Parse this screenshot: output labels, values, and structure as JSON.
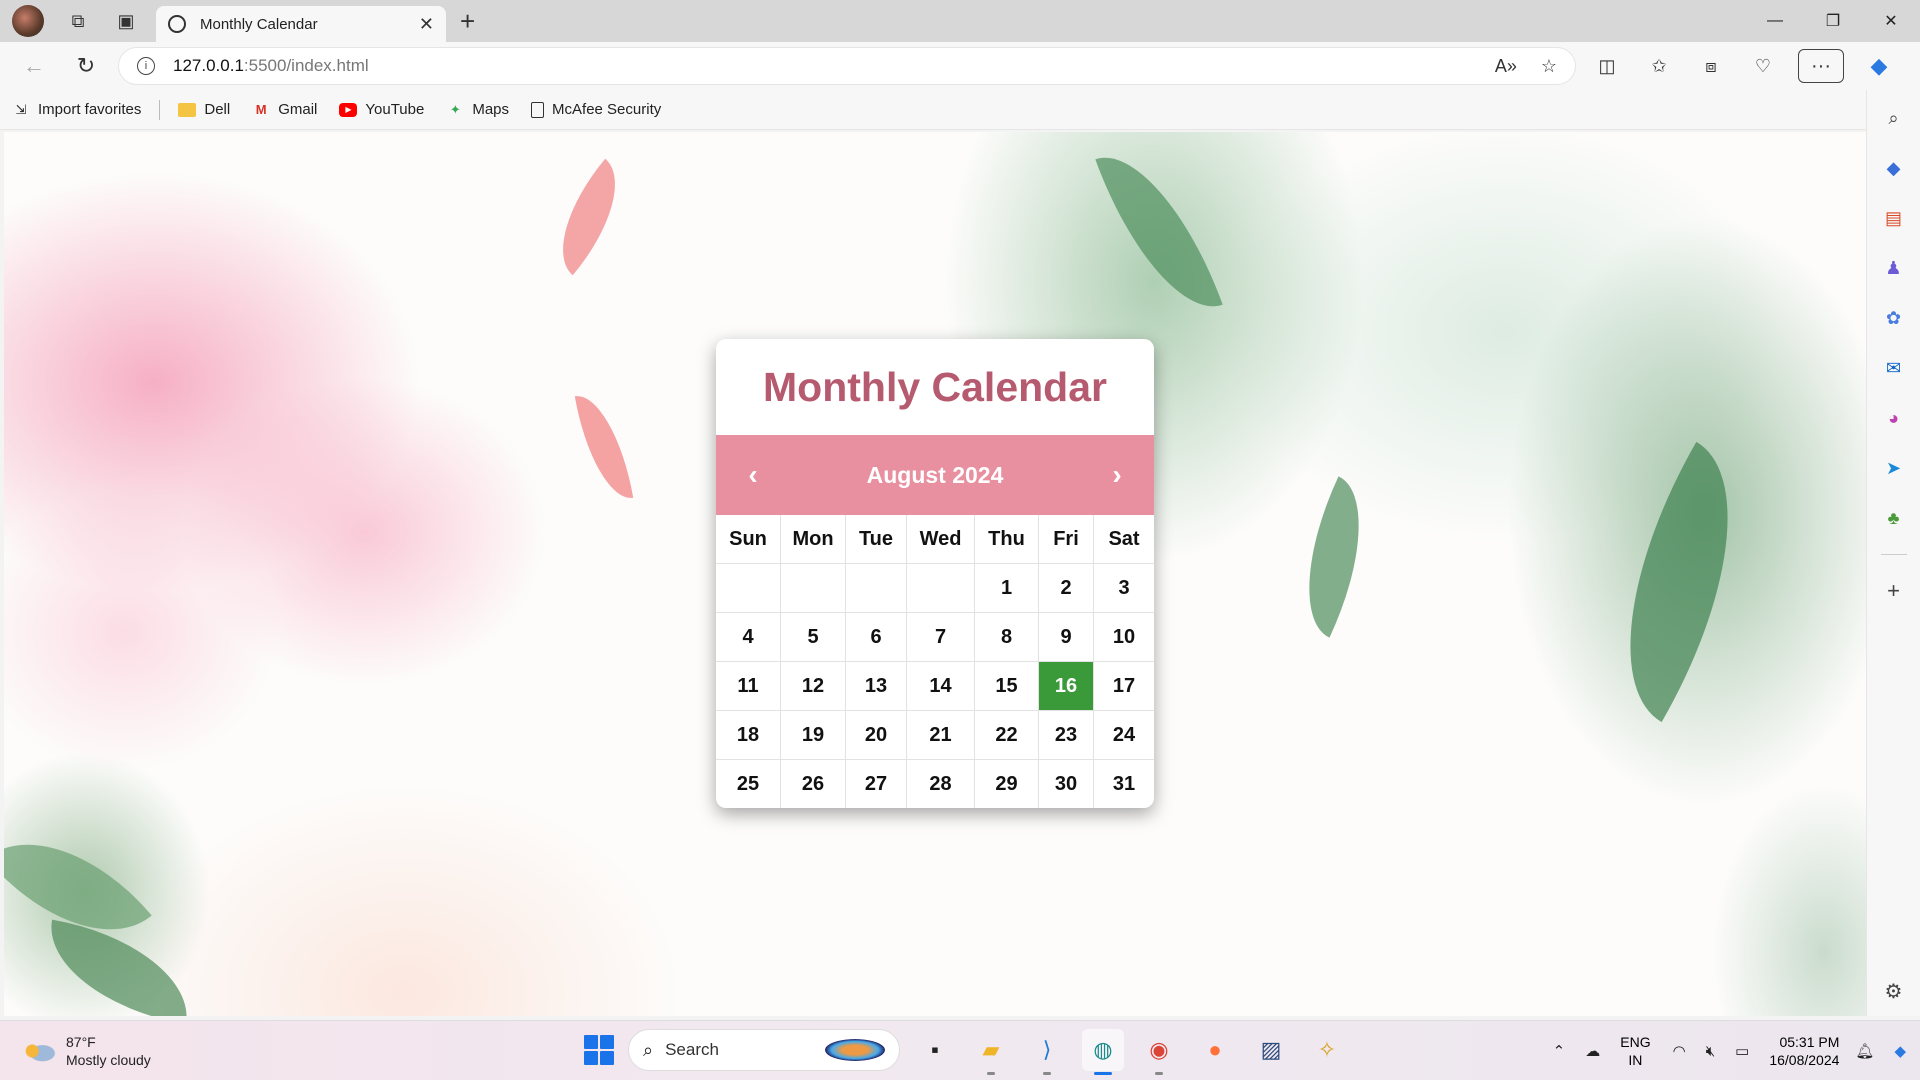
{
  "browser": {
    "tab_title": "Monthly Calendar",
    "new_tab_label": "+",
    "url_host": "127.0.0.1",
    "url_path": ":5500/index.html",
    "window_controls": [
      "—",
      "❐",
      "✕"
    ]
  },
  "favorites": [
    {
      "label": "Import favorites",
      "icon": "import-icon"
    },
    {
      "label": "Dell",
      "icon": "folder-icon"
    },
    {
      "label": "Gmail",
      "icon": "gmail-icon"
    },
    {
      "label": "YouTube",
      "icon": "youtube-icon"
    },
    {
      "label": "Maps",
      "icon": "maps-icon"
    },
    {
      "label": "McAfee Security",
      "icon": "document-icon"
    }
  ],
  "calendar": {
    "title": "Monthly Calendar",
    "month_label": "August 2024",
    "prev_label": "‹",
    "next_label": "›",
    "weekdays": [
      "Sun",
      "Mon",
      "Tue",
      "Wed",
      "Thu",
      "Fri",
      "Sat"
    ],
    "days": [
      "",
      "",
      "",
      "",
      "1",
      "2",
      "3",
      "4",
      "5",
      "6",
      "7",
      "8",
      "9",
      "10",
      "11",
      "12",
      "13",
      "14",
      "15",
      "16",
      "17",
      "18",
      "19",
      "20",
      "21",
      "22",
      "23",
      "24",
      "25",
      "26",
      "27",
      "28",
      "29",
      "30",
      "31"
    ],
    "today": "16",
    "accent_color": "#e8909f",
    "title_color": "#b55a6f",
    "today_color": "#3a9a3a"
  },
  "taskbar": {
    "weather_temp": "87°F",
    "weather_desc": "Mostly cloudy",
    "search_placeholder": "Search",
    "lang_line1": "ENG",
    "lang_line2": "IN",
    "time": "05:31 PM",
    "date": "16/08/2024"
  }
}
